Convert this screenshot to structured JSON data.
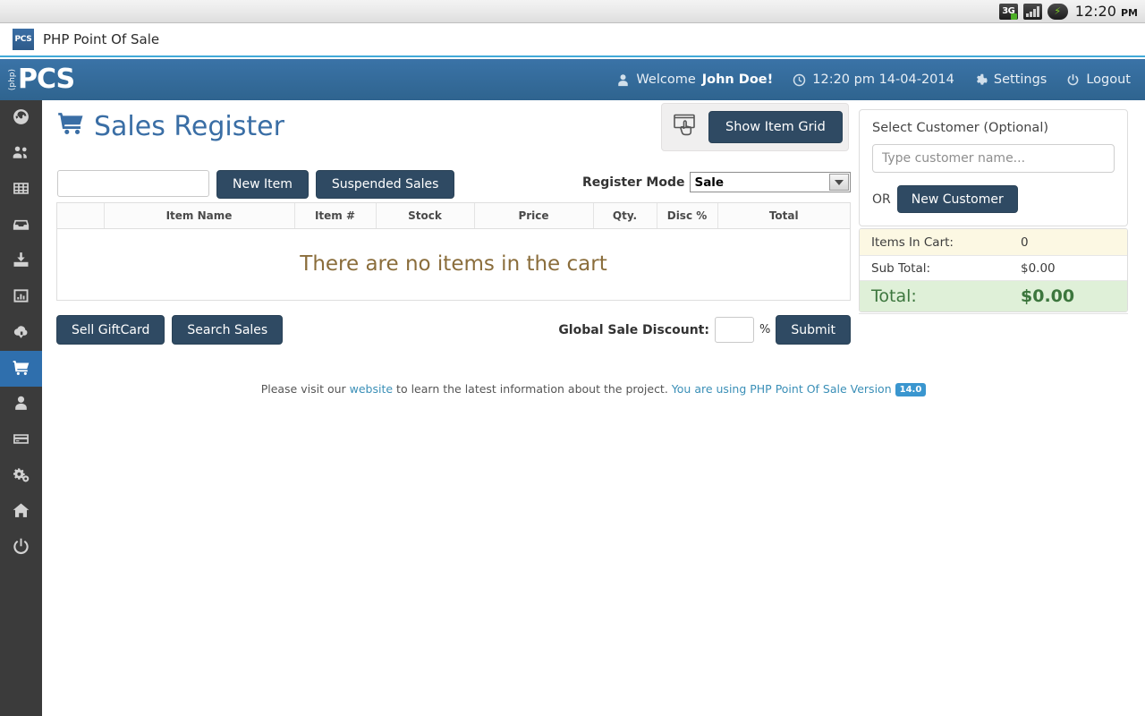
{
  "status_bar": {
    "network_label": "3G",
    "time": "12:20",
    "ampm": "PM",
    "network_icon": "3g-signal-icon",
    "signal_icon": "signal-bars-icon",
    "battery_icon": "battery-charging-icon"
  },
  "browser": {
    "favicon_text": "PCS",
    "title": "PHP Point Of Sale"
  },
  "header": {
    "brand_php": "(php)",
    "brand_pos": "PCS",
    "welcome_prefix": "Welcome ",
    "welcome_user": "John Doe!",
    "datetime": "12:20 pm 14-04-2014",
    "settings_label": "Settings",
    "logout_label": "Logout",
    "accent_color": "#336b9e"
  },
  "sidebar": {
    "items": [
      {
        "icon": "dashboard-gauge-icon",
        "active": false
      },
      {
        "icon": "customers-group-icon",
        "active": false
      },
      {
        "icon": "grid-table-icon",
        "active": false
      },
      {
        "icon": "inbox-tray-icon",
        "active": false
      },
      {
        "icon": "receivings-download-icon",
        "active": false
      },
      {
        "icon": "reports-chart-icon",
        "active": false
      },
      {
        "icon": "cloud-download-icon",
        "active": false
      },
      {
        "icon": "sales-cart-icon",
        "active": true
      },
      {
        "icon": "employee-person-icon",
        "active": false
      },
      {
        "icon": "payments-card-icon",
        "active": false
      },
      {
        "icon": "config-gears-icon",
        "active": false
      },
      {
        "icon": "home-icon",
        "active": false
      },
      {
        "icon": "power-logout-icon",
        "active": false
      }
    ],
    "active_color": "#2f6fad"
  },
  "main": {
    "page_title": "Sales Register",
    "page_title_icon": "shopping-cart-icon",
    "show_item_grid_label": "Show Item Grid",
    "show_item_grid_icon": "hand-pointing-screen-icon",
    "search_value": "",
    "search_placeholder": "",
    "new_item_label": "New Item",
    "suspended_sales_label": "Suspended Sales",
    "register_mode_label": "Register Mode",
    "register_mode_value": "Sale",
    "register_mode_options": [
      "Sale"
    ],
    "cart": {
      "columns": [
        "",
        "Item Name",
        "Item #",
        "Stock",
        "Price",
        "Qty.",
        "Disc %",
        "Total"
      ],
      "rows": [],
      "empty_message": "There are no items in the cart"
    },
    "sell_giftcard_label": "Sell GiftCard",
    "search_sales_label": "Search Sales",
    "global_discount_label": "Global Sale Discount:",
    "global_discount_value": "",
    "percent_sign": "%",
    "submit_label": "Submit"
  },
  "customer": {
    "title": "Select Customer (Optional)",
    "input_value": "",
    "input_placeholder": "Type customer name...",
    "or_label": "OR",
    "new_customer_label": "New Customer"
  },
  "totals": {
    "items_in_cart_label": "Items In Cart:",
    "items_in_cart_value": "0",
    "sub_total_label": "Sub Total:",
    "sub_total_value": "$0.00",
    "total_label": "Total:",
    "total_value": "$0.00",
    "highlight_color": "#fcf8e3",
    "total_color": "#dff0d8"
  },
  "footer": {
    "text_before": "Please visit our ",
    "website_link": "website",
    "text_middle": " to learn the latest information about the project. ",
    "version_text": "You are using PHP Point Of Sale Version",
    "version_badge": "14.0"
  }
}
